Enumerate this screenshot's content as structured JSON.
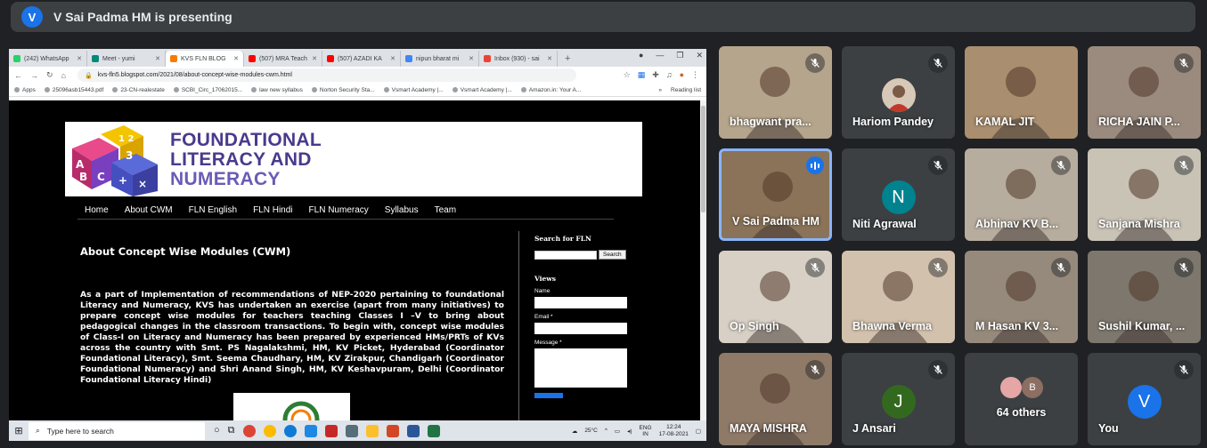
{
  "presenting": {
    "initial": "V",
    "text": "V Sai Padma HM is presenting"
  },
  "browser": {
    "tabs": [
      {
        "label": "(242) WhatsApp",
        "color": "#25d366"
      },
      {
        "label": "Meet - yumi",
        "color": "#00897b"
      },
      {
        "label": "KVS FLN BLOG",
        "color": "#f57c00",
        "active": true
      },
      {
        "label": "(507) MRA Teach",
        "color": "#ff0000"
      },
      {
        "label": "(507) AZADI KA",
        "color": "#ff0000"
      },
      {
        "label": "nipun bharat mi",
        "color": "#4285f4"
      },
      {
        "label": "Inbox (930) - sai",
        "color": "#ea4335"
      }
    ],
    "url": "kvs-fln5.blogspot.com/2021/08/about-concept-wise-modules-cwm.html",
    "bookmarks": [
      "Apps",
      "25096asb15443.pdf",
      "23-CN-realestate",
      "SCBI_Circ_17062015...",
      "law new syllabus",
      "Norton Security Sta...",
      "Vsmart Academy |...",
      "Vsmart Academy |...",
      "Amazon.in: Your A..."
    ],
    "reading_list": "Reading list"
  },
  "site": {
    "banner": {
      "line1": "FOUNDATIONAL",
      "line2": "LITERACY AND",
      "line3": "NUMERACY"
    },
    "nav": [
      "Home",
      "About CWM",
      "FLN English",
      "FLN Hindi",
      "FLN Numeracy",
      "Syllabus",
      "Team"
    ],
    "post_title": "About Concept Wise Modules (CWM)",
    "post_body": "As a part of Implementation of recommendations of NEP-2020 pertaining to foundational Literacy and Numeracy, KVS has undertaken an exercise (apart from many initiatives) to prepare concept wise modules for teachers teaching Classes I –V to bring about pedagogical changes in the classroom transactions. To begin with, concept wise modules of Class-I on Literacy and Numeracy has been prepared by experienced HMs/PRTs of KVs across the country with Smt. PS Nagalakshmi, HM, KV Picket, Hyderabad (Coordinator Foundational Literacy), Smt. Seema Chaudhary, HM, KV Zirakpur, Chandigarh (Coordinator Foundational Numeracy) and Shri Anand Singh, HM, KV Keshavpuram, Delhi (Coordinator Foundational Literacy Hindi)",
    "sidebar": {
      "search_heading": "Search for FLN",
      "search_button": "Search",
      "views_heading": "Views",
      "name_label": "Name",
      "email_label": "Email *",
      "message_label": "Message *"
    }
  },
  "taskbar": {
    "search_placeholder": "Type here to search",
    "temp": "25°C",
    "lang1": "ENG",
    "lang2": "IN",
    "time": "12:24",
    "date": "17-08-2021"
  },
  "participants": [
    {
      "name": "bhagwant pra...",
      "muted": true,
      "bg": "#b5a58c"
    },
    {
      "name": "Hariom Pandey",
      "muted": true,
      "bg": "#3c4043",
      "photo_avatar": true
    },
    {
      "name": "KAMAL JIT",
      "muted": false,
      "bg": "#a98e6f"
    },
    {
      "name": "RICHA JAIN P...",
      "muted": true,
      "bg": "#9a8b7e"
    },
    {
      "name": "V Sai Padma HM",
      "muted": false,
      "speaking": true,
      "bg": "#8a7358"
    },
    {
      "name": "Niti Agrawal",
      "muted": true,
      "bg": "#3c4043",
      "initial": "N",
      "avatar_color": "#00838f"
    },
    {
      "name": "Abhinav KV B...",
      "muted": true,
      "bg": "#b7ad9e"
    },
    {
      "name": "Sanjana Mishra",
      "muted": true,
      "bg": "#c9c3b6"
    },
    {
      "name": "Op Singh",
      "muted": true,
      "bg": "#d8d0c5"
    },
    {
      "name": "Bhawna Verma",
      "muted": true,
      "bg": "#d2c1ad"
    },
    {
      "name": "M Hasan KV 3...",
      "muted": true,
      "bg": "#968a7c"
    },
    {
      "name": "Sushil Kumar, ...",
      "muted": true,
      "bg": "#7d776d"
    },
    {
      "name": "MAYA MISHRA",
      "muted": true,
      "bg": "#8f7a68"
    },
    {
      "name": "J Ansari",
      "muted": true,
      "bg": "#3c4043",
      "initial": "J",
      "avatar_color": "#33691e"
    },
    {
      "name": "64 others",
      "muted": false,
      "bg": "#3c4043",
      "others": true,
      "others_initial": "B"
    },
    {
      "name": "You",
      "muted": true,
      "bg": "#3c4043",
      "initial": "V",
      "avatar_color": "#1a73e8"
    }
  ]
}
